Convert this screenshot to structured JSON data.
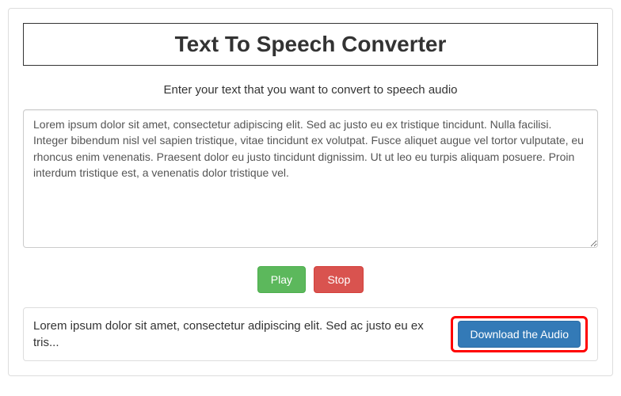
{
  "header": {
    "title": "Text To Speech Converter"
  },
  "prompt": "Enter your text that you want to convert to speech audio",
  "input": {
    "value": "Lorem ipsum dolor sit amet, consectetur adipiscing elit. Sed ac justo eu ex tristique tincidunt. Nulla facilisi. Integer bibendum nisl vel sapien tristique, vitae tincidunt ex volutpat. Fusce aliquet augue vel tortor vulputate, eu rhoncus enim venenatis. Praesent dolor eu justo tincidunt dignissim. Ut ut leo eu turpis aliquam posuere. Proin interdum tristique est, a venenatis dolor tristique vel."
  },
  "controls": {
    "play_label": "Play",
    "stop_label": "Stop"
  },
  "result": {
    "preview_text": "Lorem ipsum dolor sit amet, consectetur adipiscing elit. Sed ac justo eu ex tris...",
    "download_label": "Download the Audio"
  }
}
